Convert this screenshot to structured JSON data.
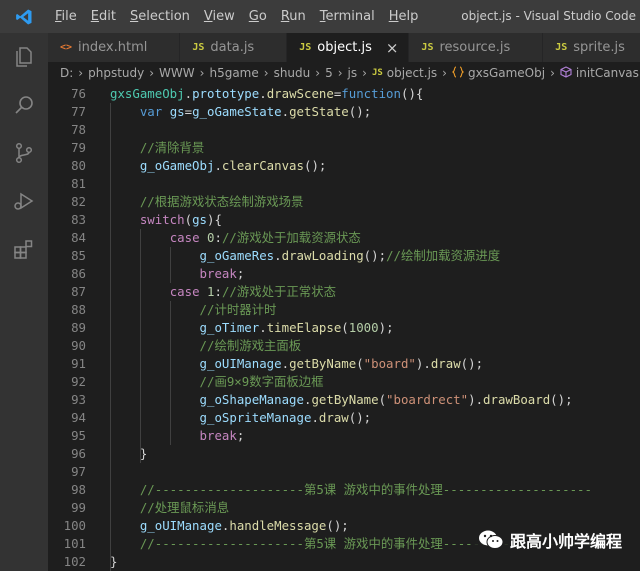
{
  "window_title": "object.js - Visual Studio Code",
  "menu": [
    {
      "key": "F",
      "rest": "ile"
    },
    {
      "key": "E",
      "rest": "dit"
    },
    {
      "key": "S",
      "rest": "election"
    },
    {
      "key": "V",
      "rest": "iew"
    },
    {
      "key": "G",
      "rest": "o"
    },
    {
      "key": "R",
      "rest": "un"
    },
    {
      "key": "T",
      "rest": "erminal"
    },
    {
      "key": "H",
      "rest": "elp"
    }
  ],
  "tabs": [
    {
      "label": "index.html",
      "icon": "<>",
      "icon_type": "html"
    },
    {
      "label": "data.js",
      "icon": "JS",
      "icon_type": "js"
    },
    {
      "label": "object.js",
      "icon": "JS",
      "icon_type": "js",
      "close": "×"
    },
    {
      "label": "resource.js",
      "icon": "JS",
      "icon_type": "js"
    },
    {
      "label": "sprite.js",
      "icon": "JS",
      "icon_type": "js"
    }
  ],
  "breadcrumb": {
    "path": [
      "D:",
      "phpstudy",
      "WWW",
      "h5game",
      "shudu",
      "5",
      "js"
    ],
    "file": "object.js",
    "file_icon": "JS",
    "object": "gxsGameObj",
    "method": "initCanvas"
  },
  "code_lines": [
    {
      "n": "76",
      "tokens": [
        [
          "cls",
          "gxsGameObj"
        ],
        [
          "op",
          "."
        ],
        [
          "var",
          "prototype"
        ],
        [
          "op",
          "."
        ],
        [
          "fn",
          "drawScene"
        ],
        [
          "op",
          "="
        ],
        [
          "kw",
          "function"
        ],
        [
          "op",
          "(){"
        ]
      ]
    },
    {
      "n": "77",
      "tokens": [
        [
          "op",
          "    "
        ],
        [
          "kw",
          "var"
        ],
        [
          "op",
          " "
        ],
        [
          "var",
          "gs"
        ],
        [
          "op",
          "="
        ],
        [
          "var",
          "g_oGameState"
        ],
        [
          "op",
          "."
        ],
        [
          "fn",
          "getState"
        ],
        [
          "op",
          "();"
        ]
      ]
    },
    {
      "n": "78",
      "tokens": []
    },
    {
      "n": "79",
      "tokens": [
        [
          "op",
          "    "
        ],
        [
          "cm",
          "//清除背景"
        ]
      ]
    },
    {
      "n": "80",
      "tokens": [
        [
          "op",
          "    "
        ],
        [
          "var",
          "g_oGameObj"
        ],
        [
          "op",
          "."
        ],
        [
          "fn",
          "clearCanvas"
        ],
        [
          "op",
          "();"
        ]
      ]
    },
    {
      "n": "81",
      "tokens": []
    },
    {
      "n": "82",
      "tokens": [
        [
          "op",
          "    "
        ],
        [
          "cm",
          "//根据游戏状态绘制游戏场景"
        ]
      ]
    },
    {
      "n": "83",
      "tokens": [
        [
          "op",
          "    "
        ],
        [
          "ctl",
          "switch"
        ],
        [
          "op",
          "("
        ],
        [
          "var",
          "gs"
        ],
        [
          "op",
          "){"
        ]
      ]
    },
    {
      "n": "84",
      "tokens": [
        [
          "op",
          "        "
        ],
        [
          "ctl",
          "case"
        ],
        [
          "op",
          " "
        ],
        [
          "num",
          "0"
        ],
        [
          "op",
          ":"
        ],
        [
          "cm",
          "//游戏处于加载资源状态"
        ]
      ]
    },
    {
      "n": "85",
      "tokens": [
        [
          "op",
          "            "
        ],
        [
          "var",
          "g_oGameRes"
        ],
        [
          "op",
          "."
        ],
        [
          "fn",
          "drawLoading"
        ],
        [
          "op",
          "();"
        ],
        [
          "cm",
          "//绘制加载资源进度"
        ]
      ]
    },
    {
      "n": "86",
      "tokens": [
        [
          "op",
          "            "
        ],
        [
          "ctl",
          "break"
        ],
        [
          "op",
          ";"
        ]
      ]
    },
    {
      "n": "87",
      "tokens": [
        [
          "op",
          "        "
        ],
        [
          "ctl",
          "case"
        ],
        [
          "op",
          " "
        ],
        [
          "num",
          "1"
        ],
        [
          "op",
          ":"
        ],
        [
          "cm",
          "//游戏处于正常状态"
        ]
      ]
    },
    {
      "n": "88",
      "tokens": [
        [
          "op",
          "            "
        ],
        [
          "cm",
          "//计时器计时"
        ]
      ]
    },
    {
      "n": "89",
      "tokens": [
        [
          "op",
          "            "
        ],
        [
          "var",
          "g_oTimer"
        ],
        [
          "op",
          "."
        ],
        [
          "fn",
          "timeElapse"
        ],
        [
          "op",
          "("
        ],
        [
          "num",
          "1000"
        ],
        [
          "op",
          ");"
        ]
      ]
    },
    {
      "n": "90",
      "tokens": [
        [
          "op",
          "            "
        ],
        [
          "cm",
          "//绘制游戏主面板"
        ]
      ]
    },
    {
      "n": "91",
      "tokens": [
        [
          "op",
          "            "
        ],
        [
          "var",
          "g_oUIManage"
        ],
        [
          "op",
          "."
        ],
        [
          "fn",
          "getByName"
        ],
        [
          "op",
          "("
        ],
        [
          "str",
          "\"board\""
        ],
        [
          "op",
          ")."
        ],
        [
          "fn",
          "draw"
        ],
        [
          "op",
          "();"
        ]
      ]
    },
    {
      "n": "92",
      "tokens": [
        [
          "op",
          "            "
        ],
        [
          "cm",
          "//画9×9数字面板边框"
        ]
      ]
    },
    {
      "n": "93",
      "tokens": [
        [
          "op",
          "            "
        ],
        [
          "var",
          "g_oShapeManage"
        ],
        [
          "op",
          "."
        ],
        [
          "fn",
          "getByName"
        ],
        [
          "op",
          "("
        ],
        [
          "str",
          "\"boardrect\""
        ],
        [
          "op",
          ")."
        ],
        [
          "fn",
          "drawBoard"
        ],
        [
          "op",
          "();"
        ]
      ]
    },
    {
      "n": "94",
      "tokens": [
        [
          "op",
          "            "
        ],
        [
          "var",
          "g_oSpriteManage"
        ],
        [
          "op",
          "."
        ],
        [
          "fn",
          "draw"
        ],
        [
          "op",
          "();"
        ]
      ]
    },
    {
      "n": "95",
      "tokens": [
        [
          "op",
          "            "
        ],
        [
          "ctl",
          "break"
        ],
        [
          "op",
          ";"
        ]
      ]
    },
    {
      "n": "96",
      "tokens": [
        [
          "op",
          "    }"
        ]
      ]
    },
    {
      "n": "97",
      "tokens": []
    },
    {
      "n": "98",
      "tokens": [
        [
          "op",
          "    "
        ],
        [
          "cm",
          "//--------------------第5课 游戏中的事件处理--------------------"
        ]
      ]
    },
    {
      "n": "99",
      "tokens": [
        [
          "op",
          "    "
        ],
        [
          "cm",
          "//处理鼠标消息"
        ]
      ]
    },
    {
      "n": "100",
      "tokens": [
        [
          "op",
          "    "
        ],
        [
          "var",
          "g_oUIManage"
        ],
        [
          "op",
          "."
        ],
        [
          "fn",
          "handleMessage"
        ],
        [
          "op",
          "();"
        ]
      ]
    },
    {
      "n": "101",
      "tokens": [
        [
          "op",
          "    "
        ],
        [
          "cm",
          "//--------------------第5课 游戏中的事件处理--------------------"
        ]
      ]
    },
    {
      "n": "102",
      "tokens": [
        [
          "op",
          "}"
        ]
      ]
    }
  ],
  "watermark": {
    "text": "跟高小帅学编程"
  },
  "colors": {
    "accent": "#007acc",
    "background": "#1e1e1e"
  }
}
